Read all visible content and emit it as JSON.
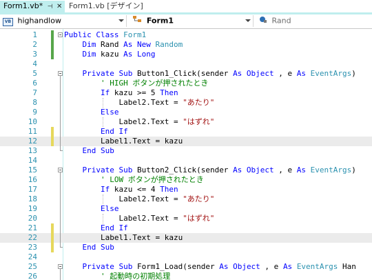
{
  "tabs": [
    {
      "label": "Form1.vb*",
      "pin": "⊣",
      "close": "✕"
    },
    {
      "label": "Form1.vb [デザイン]"
    }
  ],
  "nav": {
    "class_dropdown": {
      "label": "highandlow",
      "icon": "VB"
    },
    "object_dropdown": {
      "label": "Form1"
    },
    "member_dropdown": {
      "label": "Rand"
    }
  },
  "colors": {
    "keyword": "#0000ff",
    "type": "#2b91af",
    "string": "#a31515",
    "comment": "#008000",
    "line_number": "#2b91af",
    "active_tab": "#bfeeee",
    "change_saved": "#57a64a",
    "change_unsaved": "#e6d85c",
    "current_line": "#ebebeb"
  },
  "lines": [
    {
      "n": "1",
      "mark": "green",
      "fold": "open",
      "segs": [
        [
          "kw",
          "Public Class "
        ],
        [
          "ty",
          "Form1"
        ]
      ]
    },
    {
      "n": "2",
      "mark": "green",
      "segs": [
        [
          "",
          "    "
        ],
        [
          "kw",
          "Dim"
        ],
        [
          "",
          " Rand "
        ],
        [
          "kw",
          "As New "
        ],
        [
          "ty",
          "Random"
        ]
      ]
    },
    {
      "n": "3",
      "mark": "green",
      "segs": [
        [
          "",
          "    "
        ],
        [
          "kw",
          "Dim"
        ],
        [
          "",
          " kazu "
        ],
        [
          "kw",
          "As Long"
        ]
      ]
    },
    {
      "n": "4",
      "segs": []
    },
    {
      "n": "5",
      "fold": "open",
      "segs": [
        [
          "",
          "    "
        ],
        [
          "kw",
          "Private Sub"
        ],
        [
          "",
          " Button1_Click(sender "
        ],
        [
          "kw",
          "As Object"
        ],
        [
          "",
          " , e "
        ],
        [
          "kw",
          "As "
        ],
        [
          "ty",
          "EventArgs"
        ],
        [
          "",
          ")"
        ]
      ]
    },
    {
      "n": "6",
      "segs": [
        [
          "",
          "        "
        ],
        [
          "cm",
          "' HIGH ボタンが押されたとき"
        ]
      ]
    },
    {
      "n": "7",
      "segs": [
        [
          "",
          "        "
        ],
        [
          "kw",
          "If"
        ],
        [
          "",
          " kazu >= 5 "
        ],
        [
          "kw",
          "Then"
        ]
      ]
    },
    {
      "n": "8",
      "segs": [
        [
          "",
          "            Label2.Text = "
        ],
        [
          "st",
          "\"あたり\""
        ]
      ]
    },
    {
      "n": "9",
      "segs": [
        [
          "",
          "        "
        ],
        [
          "kw",
          "Else"
        ]
      ]
    },
    {
      "n": "10",
      "segs": [
        [
          "",
          "            Label2.Text = "
        ],
        [
          "st",
          "\"はずれ\""
        ]
      ]
    },
    {
      "n": "11",
      "mark": "yellow",
      "segs": [
        [
          "",
          "        "
        ],
        [
          "kw",
          "End If"
        ]
      ]
    },
    {
      "n": "12",
      "mark": "yellow",
      "hl": true,
      "segs": [
        [
          "",
          "        Label1.Text = kazu"
        ]
      ]
    },
    {
      "n": "13",
      "segs": [
        [
          "",
          "    "
        ],
        [
          "kw",
          "End Sub"
        ]
      ]
    },
    {
      "n": "14",
      "segs": []
    },
    {
      "n": "15",
      "fold": "open",
      "segs": [
        [
          "",
          "    "
        ],
        [
          "kw",
          "Private Sub"
        ],
        [
          "",
          " Button2_Click(sender "
        ],
        [
          "kw",
          "As Object"
        ],
        [
          "",
          " , e "
        ],
        [
          "kw",
          "As "
        ],
        [
          "ty",
          "EventArgs"
        ],
        [
          "",
          ")"
        ]
      ]
    },
    {
      "n": "16",
      "segs": [
        [
          "",
          "        "
        ],
        [
          "cm",
          "' LOW ボタンが押されたとき"
        ]
      ]
    },
    {
      "n": "17",
      "segs": [
        [
          "",
          "        "
        ],
        [
          "kw",
          "If"
        ],
        [
          "",
          " kazu <= 4 "
        ],
        [
          "kw",
          "Then"
        ]
      ]
    },
    {
      "n": "18",
      "segs": [
        [
          "",
          "            Label2.Text = "
        ],
        [
          "st",
          "\"あたり\""
        ]
      ]
    },
    {
      "n": "19",
      "segs": [
        [
          "",
          "        "
        ],
        [
          "kw",
          "Else"
        ]
      ]
    },
    {
      "n": "20",
      "segs": [
        [
          "",
          "            Label2.Text = "
        ],
        [
          "st",
          "\"はずれ\""
        ]
      ]
    },
    {
      "n": "21",
      "mark": "yellow",
      "segs": [
        [
          "",
          "        "
        ],
        [
          "kw",
          "End If"
        ]
      ]
    },
    {
      "n": "22",
      "mark": "yellow",
      "hl": true,
      "segs": [
        [
          "",
          "        Label1.Text = kazu"
        ]
      ]
    },
    {
      "n": "23",
      "mark": "yellow",
      "segs": [
        [
          "",
          "    "
        ],
        [
          "kw",
          "End Sub"
        ]
      ]
    },
    {
      "n": "24",
      "segs": []
    },
    {
      "n": "25",
      "fold": "open",
      "segs": [
        [
          "",
          "    "
        ],
        [
          "kw",
          "Private Sub"
        ],
        [
          "",
          " Form1_Load(sender "
        ],
        [
          "kw",
          "As Object"
        ],
        [
          "",
          " , e "
        ],
        [
          "kw",
          "As "
        ],
        [
          "ty",
          "EventArgs"
        ],
        [
          "",
          " Han"
        ]
      ]
    },
    {
      "n": "26",
      "segs": [
        [
          "",
          "        "
        ],
        [
          "cm",
          "' 起動時の初期処理"
        ]
      ]
    }
  ]
}
